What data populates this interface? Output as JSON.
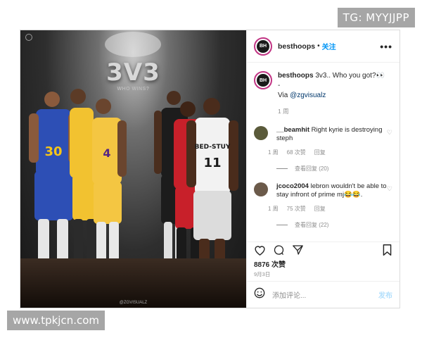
{
  "watermarks": {
    "top": "TG: MYYJJPP",
    "bottom": "www.tpkjcn.com"
  },
  "photo": {
    "title": "3V3",
    "subtitle": "WHO WINS?",
    "credit": "@ZGVISUALZ",
    "jerseys": [
      "30",
      "4",
      "11"
    ],
    "team_text": "BED-STUY"
  },
  "header": {
    "username": "besthoops",
    "separator": "•",
    "follow": "关注",
    "avatar_text": "BH"
  },
  "caption": {
    "username": "besthoops",
    "text": "3v3.. Who you got?👀",
    "dash": "-",
    "via_prefix": "Via ",
    "via_handle": "@zgvisualz",
    "time": "1 周"
  },
  "comments": [
    {
      "username": "__beamhit",
      "text": "Right kyrie is destroying steph",
      "time": "1 周",
      "likes": "68 次赞",
      "reply": "回复",
      "view_replies": "查看回复 (20)",
      "avatar_color": "#5a5a3a"
    },
    {
      "username": "jcoco2004",
      "text": "lebron wouldn't be able to stay infront of prime mj😂😂.",
      "time": "1 周",
      "likes": "75 次赞",
      "reply": "回复",
      "view_replies": "查看回复 (22)",
      "avatar_color": "#6b5a4a"
    }
  ],
  "likes": "8876 次赞",
  "date": "9月3日",
  "add_comment": {
    "placeholder": "添加评论...",
    "post": "发布"
  },
  "colors": {
    "link": "#00376b",
    "follow": "#0095f6",
    "post_disabled": "#b2dffc",
    "muted": "#8e8e8e"
  }
}
